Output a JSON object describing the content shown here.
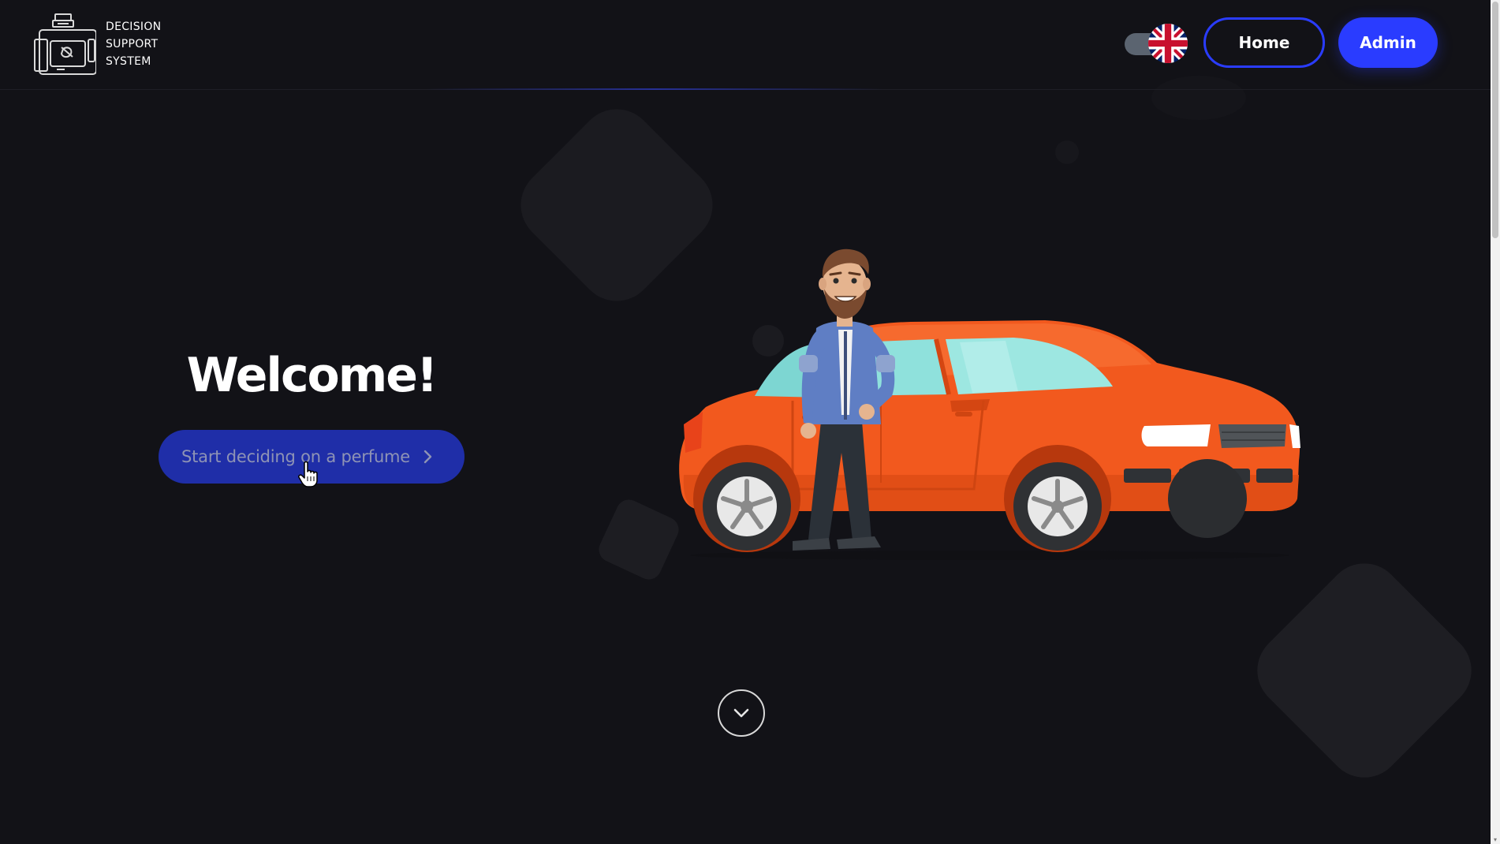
{
  "header": {
    "logo_lines": [
      "DECISION",
      "SUPPORT",
      "SYSTEM"
    ],
    "language": "en",
    "nav": {
      "home_label": "Home",
      "admin_label": "Admin"
    }
  },
  "hero": {
    "title": "Welcome!",
    "cta_label": "Start deciding on a perfume"
  },
  "icons": {
    "logo": "perfume-bottle-icon",
    "language_flag": "uk-flag-icon",
    "cta_chevron": "chevron-right-icon",
    "scroll_down": "chevron-down-icon",
    "cursor": "hand-pointer-cursor"
  },
  "colors": {
    "background": "#121217",
    "accent": "#2a3cff",
    "cta_background": "#1f2ea8",
    "car": "#f2591e"
  }
}
